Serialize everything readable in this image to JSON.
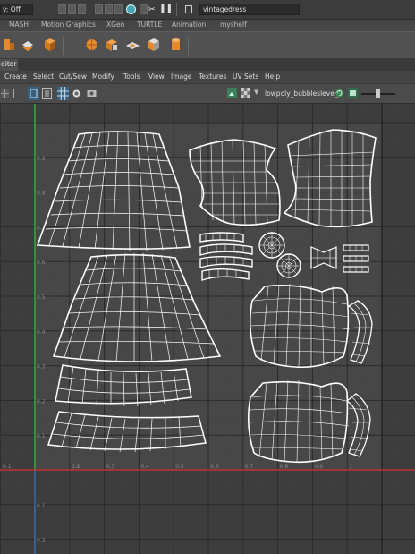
{
  "topbar": {
    "status_text": "y: Off",
    "field_value": "vintagedress"
  },
  "shelf_tabs": [
    "MASH",
    "Motion Graphics",
    "XGen",
    "TURTLE",
    "Animation",
    "myshelf"
  ],
  "editor_tab": "ditor",
  "menus": [
    "Create",
    "Select",
    "Cut/Sew",
    "Modify",
    "Tools",
    "View",
    "Image",
    "Textures",
    "UV Sets",
    "Help"
  ],
  "toolbar": {
    "uv_set_name": "lowpoly_bubblesleve_"
  },
  "axis_ticks": {
    "x": [
      "0.1",
      "0.1",
      "0.2",
      "0.3",
      "0.4",
      "0.5",
      "0.6",
      "0.7",
      "0.8",
      "0.9",
      "1"
    ],
    "y_up": [
      "0.9",
      "0.8",
      "0.7",
      "0.6",
      "0.5",
      "0.4",
      "0.3",
      "0.2",
      "0.1"
    ],
    "y_down": [
      "0.1",
      "0.2"
    ]
  },
  "colors": {
    "u_axis": "#c0303a",
    "v_axis": "#2fa83a",
    "wire": "#ffffff",
    "grid": "#4c4c4c",
    "accent": "#e67e22"
  }
}
